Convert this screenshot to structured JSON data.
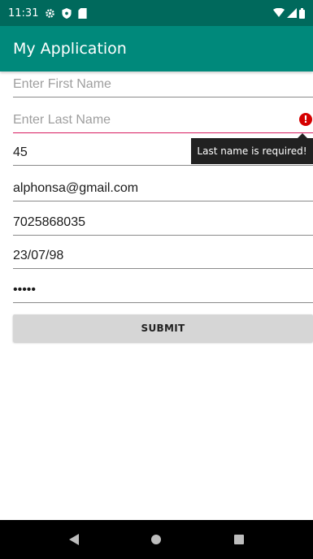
{
  "status_bar": {
    "time": "11:31",
    "left_icons": [
      "gear-icon",
      "shield-icon",
      "sd-card-icon"
    ],
    "right_icons": [
      "wifi-icon",
      "signal-icon",
      "battery-icon"
    ]
  },
  "app_bar": {
    "title": "My Application",
    "color": "#00897b"
  },
  "form": {
    "first_name": {
      "value": "",
      "placeholder": "Enter First Name"
    },
    "last_name": {
      "value": "",
      "placeholder": "Enter Last Name",
      "error": "Last name is required!"
    },
    "age": {
      "value": "45"
    },
    "email": {
      "value": "alphonsa@gmail.com"
    },
    "phone": {
      "value": "7025868035"
    },
    "dob": {
      "value": "23/07/98"
    },
    "password": {
      "value": "•••••"
    },
    "submit_label": "SUBMIT"
  },
  "nav_bar": {
    "buttons": [
      "back-icon",
      "home-icon",
      "recents-icon"
    ]
  }
}
